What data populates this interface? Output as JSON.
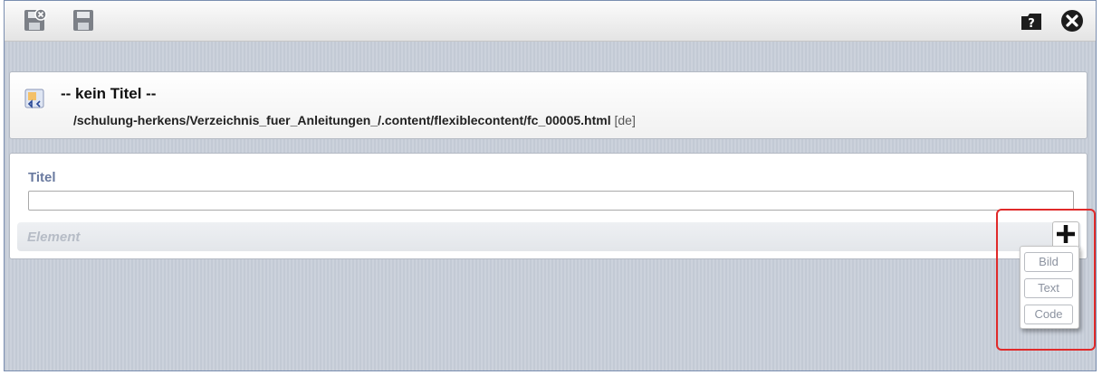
{
  "toolbar": {
    "icons": [
      "save-exit-icon",
      "save-icon",
      "help-icon",
      "close-icon"
    ]
  },
  "resource": {
    "title": "-- kein Titel --",
    "path": "/schulung-herkens/Verzeichnis_fuer_Anleitungen_/.content/flexiblecontent/fc_00005.html",
    "locale": "[de]"
  },
  "form": {
    "title_label": "Titel",
    "title_value": "",
    "element_label": "Element"
  },
  "add_menu": {
    "items": [
      "Bild",
      "Text",
      "Code"
    ]
  },
  "colors": {
    "highlight": "#e02a2a",
    "label": "#6a7aa0"
  }
}
